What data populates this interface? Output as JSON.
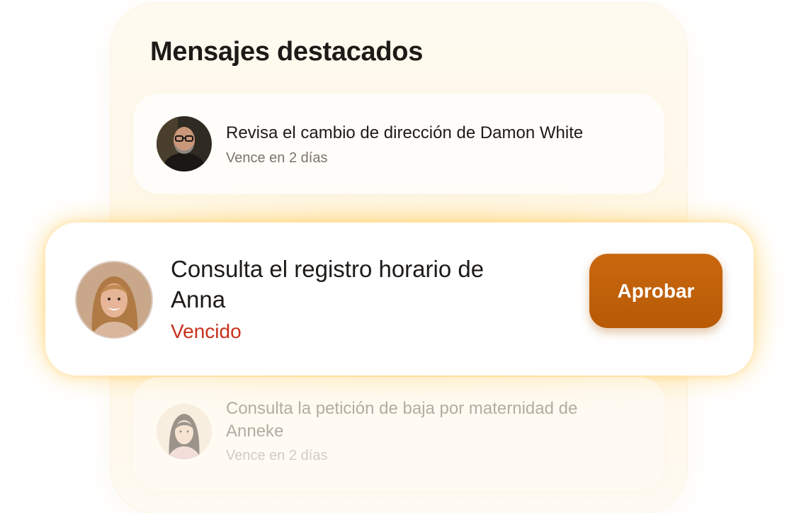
{
  "panel": {
    "title": "Mensajes destacados"
  },
  "messages": [
    {
      "title": "Revisa el cambio de dirección de Damon White",
      "subtitle": "Vence en 2 días",
      "avatar": "man-avatar"
    },
    {
      "title": "Consulta el registro horario de Anna",
      "status": "Vencido",
      "avatar": "woman-avatar",
      "action_label": "Aprobar"
    },
    {
      "title": "Consulta la petición de baja por maternidad de Anneke",
      "subtitle": "Vence en 2 días",
      "avatar": "woman-avatar"
    }
  ],
  "colors": {
    "accent": "#b95c07",
    "overdue": "#c9301c",
    "highlight_glow": "#ffd25a"
  }
}
